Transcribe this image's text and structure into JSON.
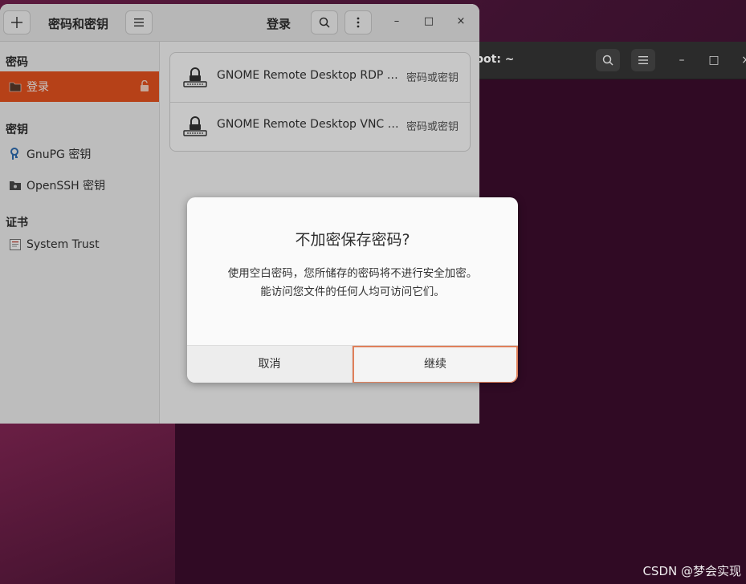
{
  "app": {
    "title": "密码和密钥",
    "view_title": "登录",
    "add_icon": "plus-icon",
    "menu_icon": "hamburger-icon"
  },
  "sidebar": {
    "sections": [
      {
        "label": "密码",
        "items": [
          {
            "label": "登录",
            "icon": "folder-icon",
            "selected": true,
            "locked": false
          }
        ]
      },
      {
        "label": "密钥",
        "items": [
          {
            "label": "GnuPG 密钥",
            "icon": "gpg-key-icon"
          },
          {
            "label": "OpenSSH 密钥",
            "icon": "ssh-key-icon"
          }
        ]
      },
      {
        "label": "证书",
        "items": [
          {
            "label": "System Trust",
            "icon": "certificate-icon"
          }
        ]
      }
    ]
  },
  "content": {
    "rows": [
      {
        "name": "GNOME Remote Desktop RDP credentials",
        "type": "密码或密钥"
      },
      {
        "name": "GNOME Remote Desktop VNC password",
        "type": "密码或密钥"
      }
    ]
  },
  "terminal": {
    "title": "bot: ~"
  },
  "dialog": {
    "title": "不加密保存密码?",
    "body": "使用空白密码，您所储存的密码将不进行安全加密。能访问您文件的任何人均可访问它们。",
    "cancel": "取消",
    "continue": "继续"
  },
  "watermark": "CSDN @梦会实现",
  "colors": {
    "accent": "#e9541f",
    "focus_border": "#e0805a",
    "desktop": "#300a24"
  }
}
